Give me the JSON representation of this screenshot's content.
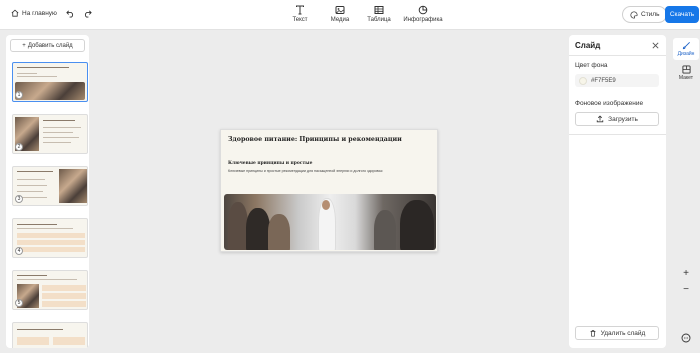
{
  "topbar": {
    "home_label": "На главную",
    "tools": [
      {
        "label": "Текст",
        "icon": "text-icon"
      },
      {
        "label": "Медиа",
        "icon": "image-icon"
      },
      {
        "label": "Таблица",
        "icon": "table-icon"
      },
      {
        "label": "Инфографика",
        "icon": "pie-chart-icon"
      }
    ],
    "style_label": "Стиль",
    "download_label": "Скачать"
  },
  "left_panel": {
    "add_slide_label": "Добавить слайд",
    "thumbnails": [
      "1",
      "2",
      "3",
      "4",
      "5"
    ]
  },
  "slide": {
    "title": "Здоровое питание: Принципы и рекомендации",
    "subtitle": "Ключевые принципы и простые",
    "description": "Ключевые принципы и простые рекомендации для насыщенной энергии и долгого здоровья"
  },
  "right_panel": {
    "title": "Слайд",
    "bg_color_label": "Цвет фона",
    "bg_color_value": "#F7F5E9",
    "bg_image_label": "Фоновое изображение",
    "upload_label": "Загрузить",
    "delete_label": "Удалить слайд"
  },
  "side_tabs": {
    "design_label": "Дизайн",
    "layout_label": "Макет"
  },
  "colors": {
    "accent": "#1677e8",
    "slide_bg": "#F7F5E9"
  }
}
